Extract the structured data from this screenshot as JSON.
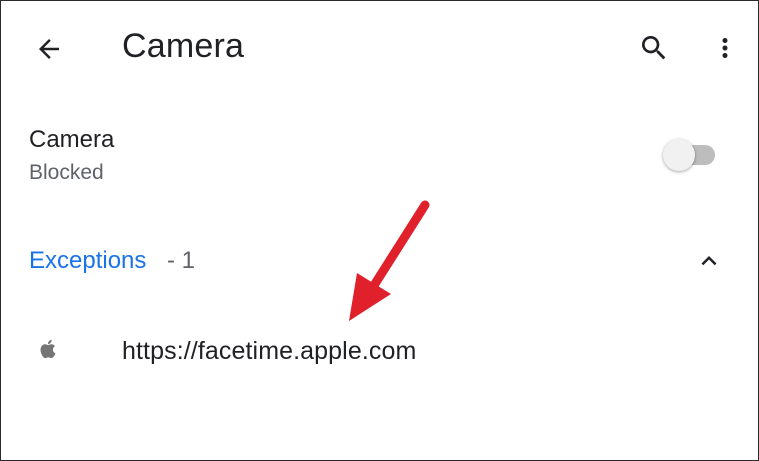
{
  "appbar": {
    "title": "Camera",
    "back_icon": "arrow-back-icon",
    "search_icon": "search-icon",
    "more_icon": "more-vert-icon"
  },
  "setting": {
    "title": "Camera",
    "subtitle": "Blocked",
    "toggle_on": false
  },
  "exceptions": {
    "label": "Exceptions",
    "count_text": " - 1",
    "expanded": true,
    "chevron_icon": "chevron-up-icon",
    "items": [
      {
        "icon": "apple-icon",
        "url": "https://facetime.apple.com"
      }
    ]
  },
  "colors": {
    "accent": "#1a73e8",
    "annotation": "#e0202b",
    "text_primary": "#202124",
    "text_secondary": "#5f6368"
  }
}
